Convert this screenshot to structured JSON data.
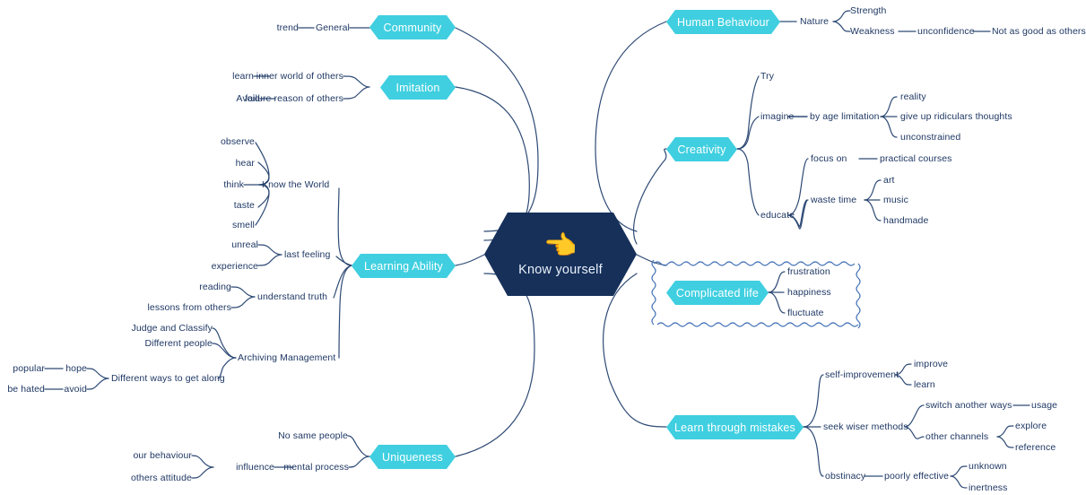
{
  "colors": {
    "branch_fill": "#3fcfe0",
    "center_fill": "#16305a",
    "line": "#2e4a75",
    "text": "#1f3864",
    "node_text": "#ffffff",
    "wavy_border": "#3f6fb5"
  },
  "center": {
    "label": "Know yourself",
    "emoji": "👈",
    "emoji_name": "pointing-hand-emoji"
  },
  "branches": [
    {
      "id": "community",
      "label": "Community"
    },
    {
      "id": "imitation",
      "label": "Imitation"
    },
    {
      "id": "learning-ability",
      "label": "Learning Ability"
    },
    {
      "id": "uniqueness",
      "label": "Uniqueness"
    },
    {
      "id": "human-behaviour",
      "label": "Human Behaviour"
    },
    {
      "id": "creativity",
      "label": "Creativity"
    },
    {
      "id": "complicated-life",
      "label": "Complicated life"
    },
    {
      "id": "learn-through-mistakes",
      "label": "Learn through mistakes"
    }
  ],
  "leaves": {
    "trend": "trend",
    "general": "General",
    "learn_imitation": "learn",
    "inner_world_of_others": "inner world of others",
    "avoid_imitation": "Avoid",
    "failure_reason_of_others": "failure reason of others",
    "observe": "observe",
    "hear": "hear",
    "think": "think",
    "taste": "taste",
    "smell": "smell",
    "know_the_world": "Know the World",
    "unreal": "unreal",
    "experience": "experience",
    "last_feeling": "last feeling",
    "reading": "reading",
    "lessons_from_others": "lessons from others",
    "understand_truth": "understand truth",
    "judge_and_classify": "Judge and Classify",
    "different_people": "Different people",
    "popular": "popular",
    "hope": "hope",
    "be_hated": "be hated",
    "avoid_get_along": "avoid",
    "different_ways_to_get_along": "Different ways to get along",
    "archiving_management": "Archiving Management",
    "no_same_people": "No same people",
    "our_behaviour": "our behaviour",
    "others_attitude": "others attitude",
    "influence": "influence",
    "mental_process": "mental process",
    "nature": "Nature",
    "strength": "Strength",
    "weakness": "Weakness",
    "unconfidence": "unconfidence",
    "not_as_good_as_others": "Not as good as others",
    "try": "Try",
    "imagine": "imagine",
    "by_age_limitation": "by age limitation",
    "reality": "reality",
    "give_up_ridiculars_thoughts": "give up ridiculars thoughts",
    "unconstrained": "unconstrained",
    "educate": "educate",
    "focus_on": "focus on",
    "practical_courses": "practical courses",
    "waste_time": "waste time",
    "art": "art",
    "music": "music",
    "handmade": "handmade",
    "frustration": "frustration",
    "happiness": "happiness",
    "fluctuate": "fluctuate",
    "self_improvement": "self-improvement",
    "improve": "improve",
    "learn_mistakes": "learn",
    "seek_wiser_methods": "seek wiser methods",
    "switch_another_ways": "switch another ways",
    "usage": "usage",
    "other_channels": "other channels",
    "explore": "explore",
    "reference": "reference",
    "obstinacy": "obstinacy",
    "poorly_effective": "poorly effective",
    "unknown": "unknown",
    "inertness": "inertness"
  }
}
